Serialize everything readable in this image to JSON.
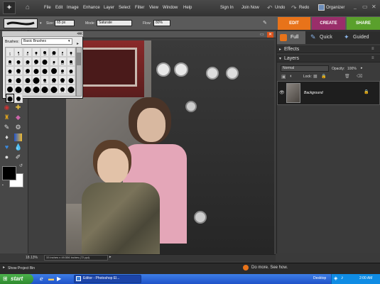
{
  "menubar": {
    "logo": "⬛",
    "items": [
      "File",
      "Edit",
      "Image",
      "Enhance",
      "Layer",
      "Select",
      "Filter",
      "View",
      "Window",
      "Help"
    ],
    "sign_in": "Sign In",
    "join_now": "Join Now",
    "undo": "Undo",
    "redo": "Redo",
    "organizer": "Organizer"
  },
  "options": {
    "size_label": "Size:",
    "size_value": "65 px",
    "mode_label": "Mode:",
    "mode_value": "Saturate",
    "flow_label": "Flow:",
    "flow_value": "80%"
  },
  "mode_tabs": {
    "edit": "EDIT",
    "create": "CREATE",
    "share": "SHARE"
  },
  "edit_modes": {
    "full": "Full",
    "quick": "Quick",
    "guided": "Guided"
  },
  "brushes": {
    "label": "Brushes:",
    "selected": "Basic Brushes",
    "rows": [
      [
        "1",
        "3",
        "5",
        "9",
        "13",
        "19",
        "",
        "",
        ""
      ],
      [
        "5",
        "9",
        "13",
        "17",
        "21",
        "27",
        "35",
        ""
      ],
      [
        "9",
        "12",
        "13",
        "19",
        "28",
        "27",
        "",
        "",
        ""
      ],
      [
        "21",
        "24",
        "35",
        "",
        "",
        "",
        "",
        ""
      ],
      [
        "59",
        "",
        "14",
        "24",
        "27",
        "39",
        "",
        "",
        ""
      ],
      [
        "46",
        "60",
        "17",
        "",
        "",
        "",
        "",
        "",
        ""
      ]
    ],
    "visible_numbers": [
      "1",
      "3",
      "5",
      "9",
      "13",
      "19",
      "5",
      "9",
      "13",
      "17",
      "21",
      "27",
      "35",
      "9",
      "12",
      "13",
      "19",
      "28",
      "27",
      "39",
      "46",
      "59",
      "11",
      "17",
      "23",
      "36",
      "44",
      "60",
      "14",
      "26",
      "33",
      "42",
      "55",
      "70",
      "112",
      "134",
      "74",
      "95",
      "29",
      "192",
      "36",
      "33"
    ]
  },
  "panel": {
    "effects": "Effects",
    "layers": "Layers",
    "blend_mode": "Normal",
    "opacity_label": "Opacity:",
    "opacity_value": "100%",
    "lock_label": "Lock:",
    "layer_name": "Background"
  },
  "status": {
    "zoom": "18.13%",
    "doc_size": "33 inches x 49.556 inches (72 ppi)",
    "project_bin": "Show Project Bin",
    "promo": "Do more. See how."
  },
  "taskbar": {
    "start": "start",
    "window_title": "Editor - Photoshop El...",
    "desktop": "Desktop",
    "clock": "2:00 AM"
  },
  "colors": {
    "edit_tab": "#e8731a",
    "create_tab": "#9a2e6a",
    "share_tab": "#5aa02c",
    "taskbar": "#2f68d8",
    "start": "#3c9c3c"
  }
}
